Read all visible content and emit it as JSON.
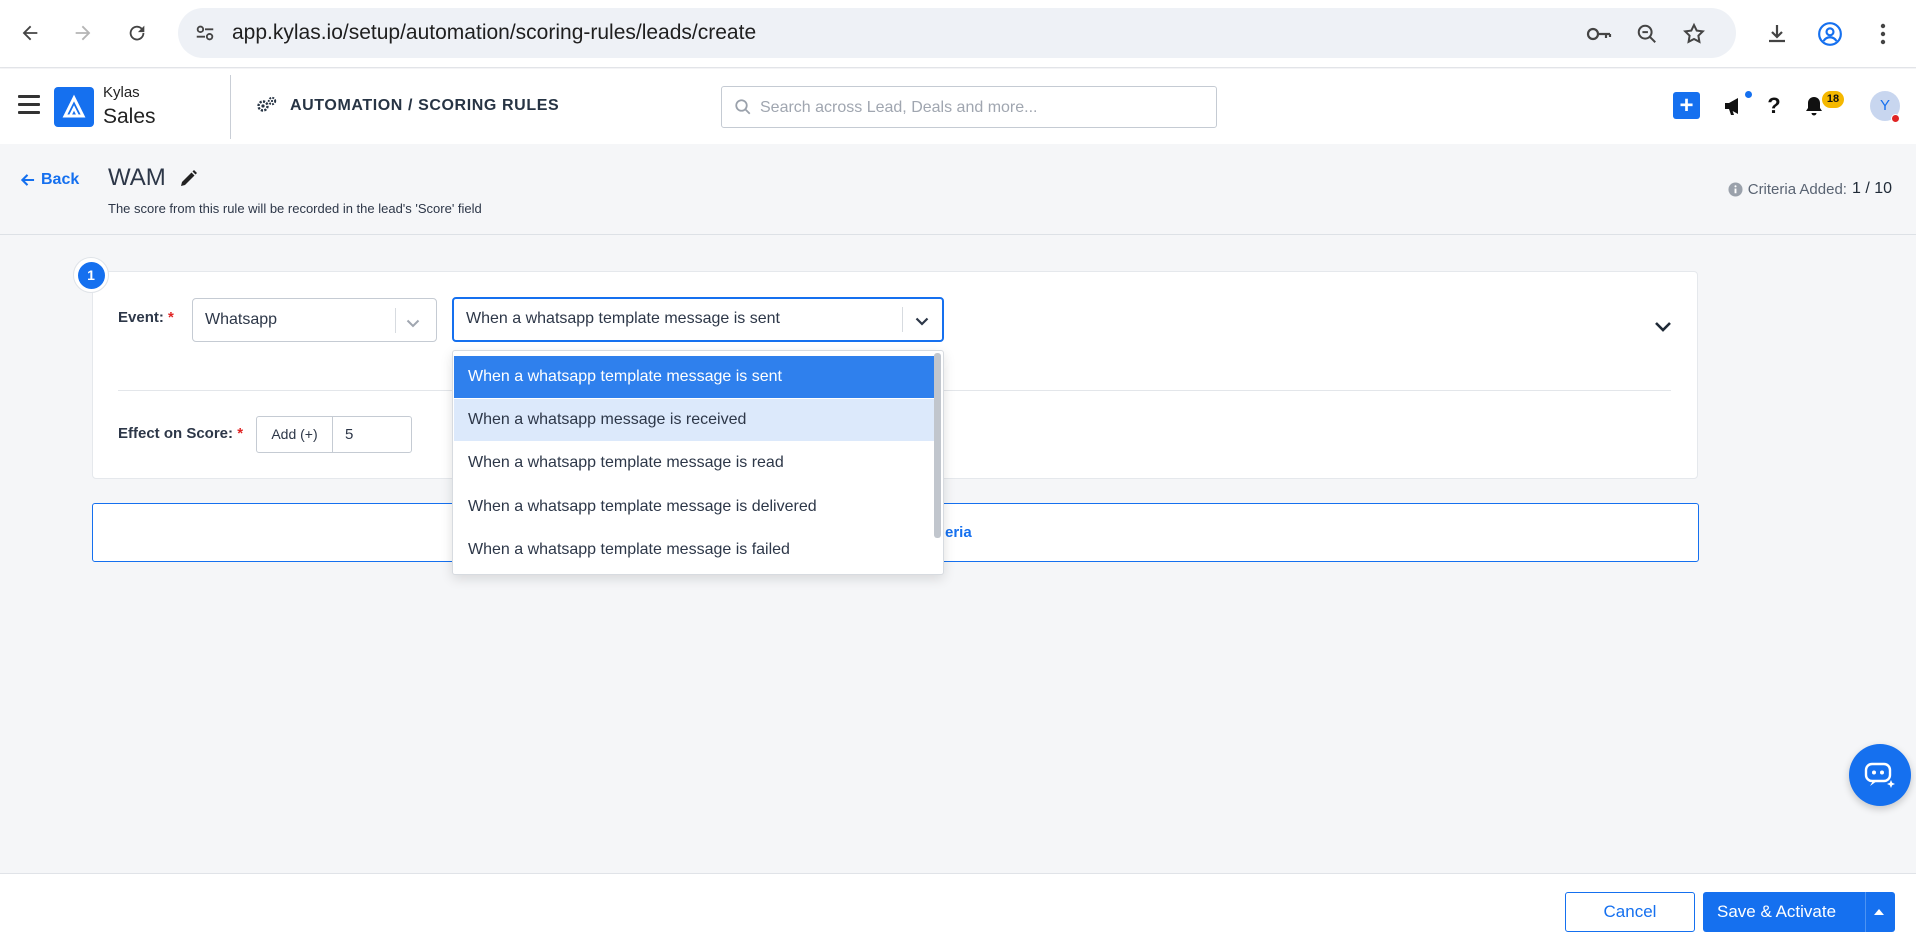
{
  "browser": {
    "url": "app.kylas.io/setup/automation/scoring-rules/leads/create"
  },
  "header": {
    "logo_top": "Kylas",
    "logo_bottom": "Sales",
    "module_title": "AUTOMATION / SCORING RULES",
    "search_placeholder": "Search across Lead, Deals and more...",
    "notification_count": "18",
    "avatar_initial": "Y"
  },
  "page": {
    "back_label": "Back",
    "rule_name": "WAM",
    "subtitle": "The score from this rule will be recorded in the lead's 'Score' field",
    "criteria_label": "Criteria Added:",
    "criteria_value": "1 / 10"
  },
  "criteria": {
    "step_number": "1",
    "event_label": "Event:",
    "required_mark": "*",
    "event_type": "Whatsapp",
    "event_action": "When a whatsapp template message is sent",
    "effect_label": "Effect on Score:",
    "operator": "Add (+)",
    "score_value": "5",
    "add_criteria_fragment": "eria"
  },
  "dropdown": {
    "options": [
      "When a whatsapp template message is sent",
      "When a whatsapp message is received",
      "When a whatsapp template message is read",
      "When a whatsapp template message is delivered",
      "When a whatsapp template message is failed"
    ],
    "selected_index": 0,
    "hovered_index": 1
  },
  "footer": {
    "cancel_label": "Cancel",
    "save_label": "Save & Activate"
  },
  "colors": {
    "primary": "#1570ef",
    "selected_option": "#2f80ed",
    "hover_option": "#dce9fb",
    "required": "#e02424",
    "badge": "#f5b800"
  }
}
